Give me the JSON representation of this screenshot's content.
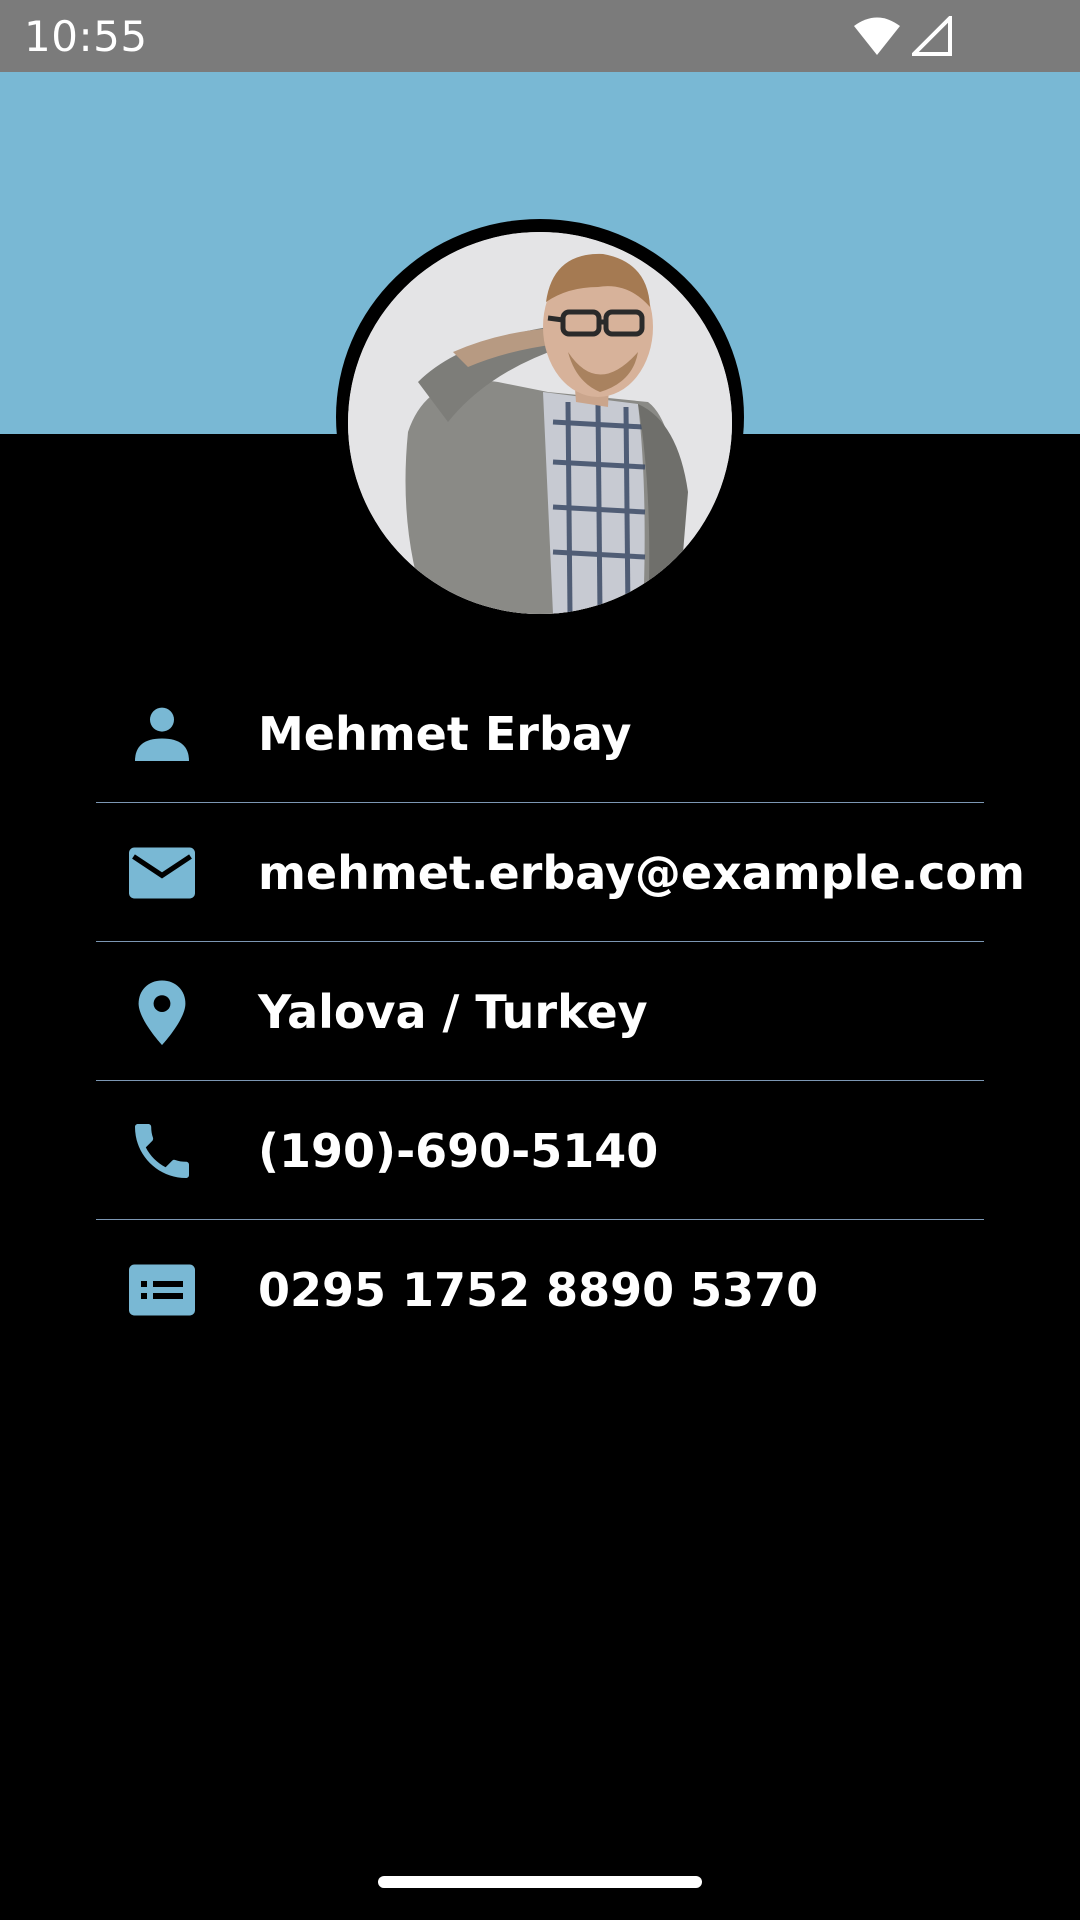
{
  "status_bar": {
    "time": "10:55",
    "icons": [
      "wifi-icon",
      "cell-signal-icon"
    ]
  },
  "colors": {
    "accent": "#79b8d4",
    "background": "#000000",
    "status_bar": "#7b7b7b",
    "divider": "#7c97b3",
    "text": "#ffffff"
  },
  "profile": {
    "avatar": "profile-photo"
  },
  "info": [
    {
      "icon": "person-icon",
      "value": "Mehmet Erbay"
    },
    {
      "icon": "email-icon",
      "value": "mehmet.erbay@example.com"
    },
    {
      "icon": "location-pin-icon",
      "value": "Yalova / Turkey"
    },
    {
      "icon": "phone-icon",
      "value": "(190)-690-5140"
    },
    {
      "icon": "id-card-icon",
      "value": "0295 1752 8890 5370"
    }
  ]
}
